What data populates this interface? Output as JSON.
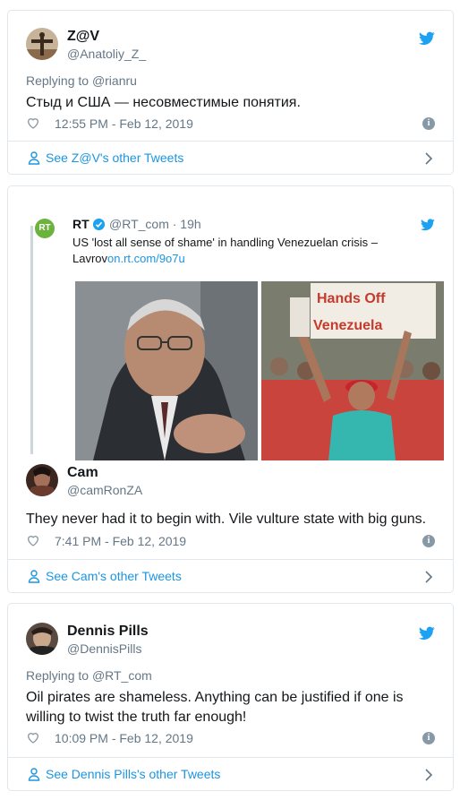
{
  "tweets": [
    {
      "name": "Z@V",
      "handle": "@Anatoliy_Z_",
      "reply_prefix": "Replying to ",
      "reply_to": "@rianru",
      "text": "Стыд и США — несовместимые понятия.",
      "timestamp": "12:55 PM - Feb 12, 2019",
      "footer": "See Z@V's other Tweets"
    },
    {
      "name": "Cam",
      "handle": "@camRonZA",
      "text": "They never had it to begin with. Vile vulture state with big guns.",
      "timestamp": "7:41 PM - Feb 12, 2019",
      "footer": "See Cam's other Tweets",
      "quoted": {
        "avatar_text": "RT",
        "name": "RT",
        "handle_time": "@RT_com · 19h",
        "text": "US 'lost all sense of shame' in handling Venezuelan crisis – Lavrov",
        "link": "on.rt.com/9o7u",
        "sign_line1": "Hands Off",
        "sign_line2": "Venezuela"
      }
    },
    {
      "name": "Dennis Pills",
      "handle": "@DennisPills",
      "reply_prefix": "Replying to ",
      "reply_to": "@RT_com",
      "text": "Oil pirates are shameless. Anything can be justified if one is willing to twist the truth far enough!",
      "timestamp": "10:09 PM - Feb 12, 2019",
      "footer": "See Dennis Pills's other Tweets"
    }
  ],
  "colors": {
    "twitter_blue": "#1da1f2",
    "link": "#1b95e0",
    "muted": "#657786",
    "border": "#e1e8ed"
  },
  "icons": [
    "twitter-bird-icon",
    "heart-icon",
    "info-icon",
    "person-icon",
    "chevron-right-icon",
    "verified-icon"
  ]
}
